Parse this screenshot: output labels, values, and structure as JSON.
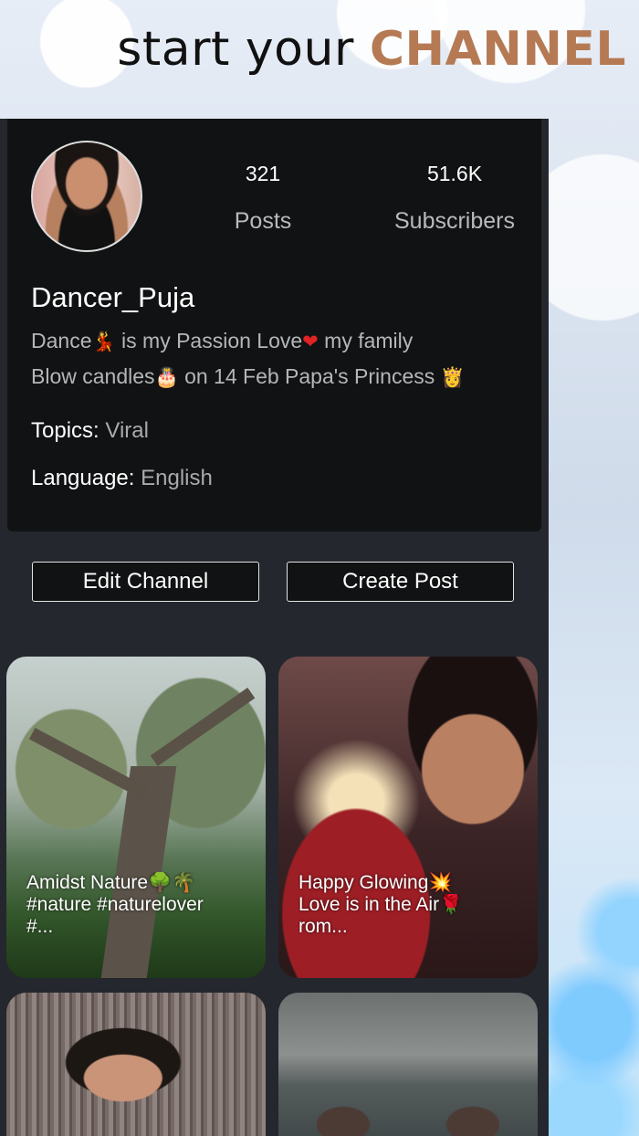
{
  "headline": {
    "prefix": "start your",
    "accent": "CHANNEL",
    "accent_color": "#b57a54"
  },
  "profile": {
    "avatar_icon": "profile-photo",
    "stats": {
      "posts_count": "321",
      "posts_label": "Posts",
      "subscribers_count": "51.6K",
      "subscribers_label": "Subscribers"
    },
    "username": "Dancer_Puja",
    "bio": {
      "line1_a": "Dance",
      "line1_emoji1": "💃",
      "line1_b": " is my Passion Love",
      "line1_emoji2": "❤",
      "line1_c": " my family",
      "line2_a": "Blow candles",
      "line2_emoji1": "🎂",
      "line2_b": " on 14 Feb Papa's Princess ",
      "line2_emoji2": "👸"
    },
    "topics_label": "Topics:",
    "topics_value": "Viral",
    "language_label": "Language:",
    "language_value": "English"
  },
  "actions": {
    "edit_label": "Edit Channel",
    "create_label": "Create Post"
  },
  "posts": [
    {
      "caption_line1": "Amidst Nature🌳🌴",
      "caption_line2": "#nature #naturelover",
      "caption_line3": "#..."
    },
    {
      "caption_line1": "Happy Glowing💥",
      "caption_line2": "Love is in the Air🌹",
      "caption_line3": "rom..."
    },
    {
      "caption_line1": "",
      "caption_line2": "",
      "caption_line3": ""
    },
    {
      "caption_line1": "",
      "caption_line2": "",
      "caption_line3": ""
    }
  ]
}
